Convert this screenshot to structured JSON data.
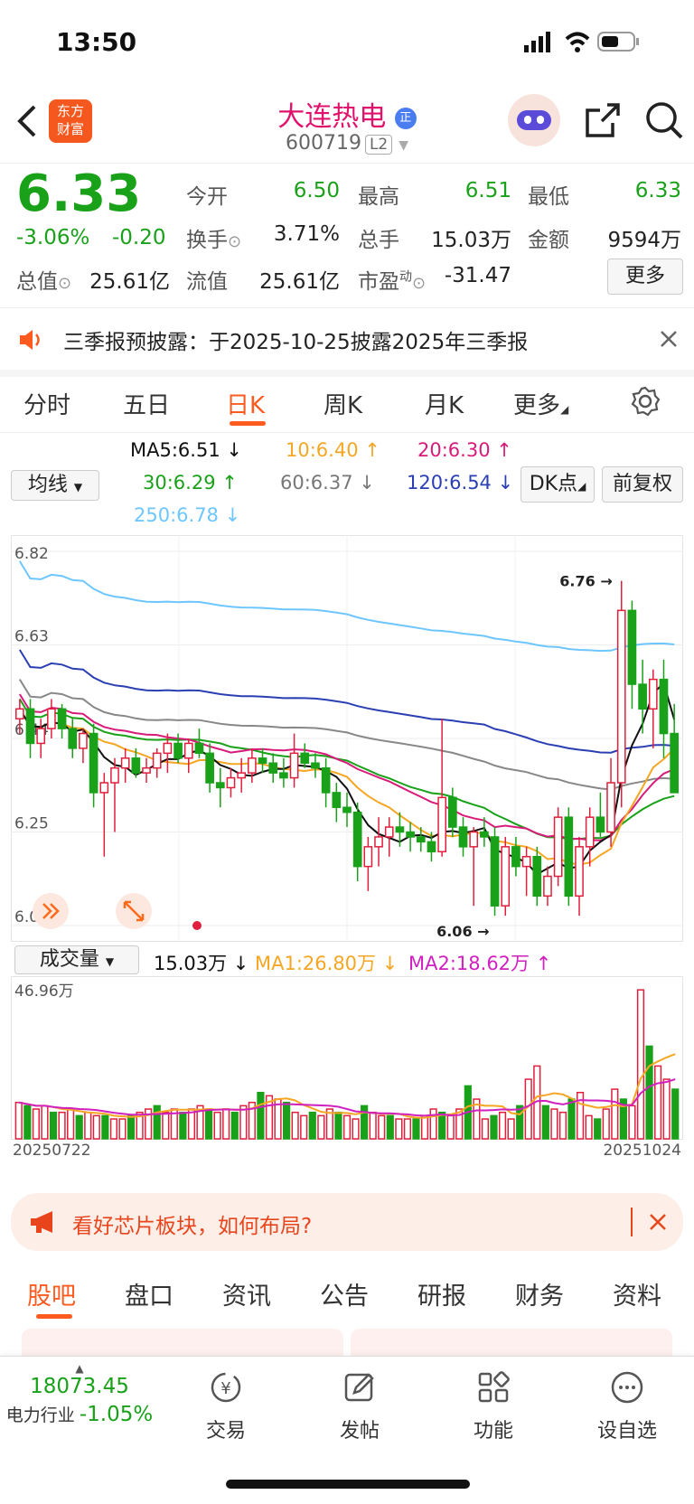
{
  "status": {
    "time": "13:50"
  },
  "header": {
    "brand_line1": "东方",
    "brand_line2": "财富",
    "title": "大连热电",
    "badge": "正",
    "code": "600719",
    "level": "L2"
  },
  "quote": {
    "price": "6.33",
    "change_pct": "-3.06%",
    "change": "-0.20",
    "open_label": "今开",
    "open": "6.50",
    "high_label": "最高",
    "high": "6.51",
    "low_label": "最低",
    "low": "6.33",
    "turnover_label": "换手",
    "turnover": "3.71%",
    "volume_label": "总手",
    "volume": "15.03万",
    "amount_label": "金额",
    "amount": "9594万",
    "mktcap_label": "总值",
    "mktcap": "25.61亿",
    "float_label": "流值",
    "float": "25.61亿",
    "pe_label": "市盈",
    "pe_sup": "动",
    "pe": "-31.47",
    "more": "更多"
  },
  "notice": {
    "text": "三季报预披露：于2025-10-25披露2025年三季报"
  },
  "ktabs": [
    "分时",
    "五日",
    "日K",
    "周K",
    "月K",
    "更多"
  ],
  "ma": {
    "selector": "均线",
    "ma5": "MA5:6.51",
    "ma10": "10:6.40",
    "ma20": "20:6.30",
    "ma30": "30:6.29",
    "ma60": "60:6.37",
    "ma120": "120:6.54",
    "ma250": "250:6.78",
    "dk": "DK点",
    "fq": "前复权"
  },
  "colors": {
    "up": "#e01f3d",
    "down": "#1aa11a",
    "ma5": "#111111",
    "ma10": "#f5a623",
    "ma20": "#d81b7a",
    "ma30": "#1aa11a",
    "ma60": "#888888",
    "ma120": "#2b3fb3",
    "ma250": "#6ec6ff",
    "accent": "#ff6a1a"
  },
  "chart_data": [
    {
      "type": "candlestick",
      "y_ticks": [
        "6.82",
        "6.63",
        "6.44",
        "6.25",
        "6.06"
      ],
      "ylim": [
        6.06,
        6.82
      ],
      "max_label": "6.76",
      "min_label": "6.06",
      "candles": [
        [
          6.48,
          6.52,
          6.45,
          6.5
        ],
        [
          6.5,
          6.52,
          6.4,
          6.43
        ],
        [
          6.43,
          6.48,
          6.4,
          6.46
        ],
        [
          6.46,
          6.52,
          6.44,
          6.5
        ],
        [
          6.5,
          6.51,
          6.44,
          6.46
        ],
        [
          6.46,
          6.48,
          6.4,
          6.42
        ],
        [
          6.42,
          6.46,
          6.39,
          6.45
        ],
        [
          6.45,
          6.47,
          6.3,
          6.33
        ],
        [
          6.33,
          6.37,
          6.2,
          6.35
        ],
        [
          6.35,
          6.4,
          6.25,
          6.38
        ],
        [
          6.38,
          6.42,
          6.35,
          6.4
        ],
        [
          6.4,
          6.42,
          6.36,
          6.37
        ],
        [
          6.37,
          6.4,
          6.35,
          6.38
        ],
        [
          6.38,
          6.42,
          6.36,
          6.41
        ],
        [
          6.41,
          6.45,
          6.37,
          6.43
        ],
        [
          6.43,
          6.45,
          6.39,
          6.4
        ],
        [
          6.4,
          6.44,
          6.37,
          6.43
        ],
        [
          6.43,
          6.46,
          6.4,
          6.41
        ],
        [
          6.41,
          6.43,
          6.33,
          6.35
        ],
        [
          6.35,
          6.38,
          6.3,
          6.34
        ],
        [
          6.34,
          6.38,
          6.32,
          6.36
        ],
        [
          6.36,
          6.4,
          6.33,
          6.37
        ],
        [
          6.37,
          6.42,
          6.35,
          6.4
        ],
        [
          6.4,
          6.42,
          6.37,
          6.39
        ],
        [
          6.39,
          6.41,
          6.35,
          6.37
        ],
        [
          6.37,
          6.4,
          6.34,
          6.36
        ],
        [
          6.36,
          6.45,
          6.34,
          6.41
        ],
        [
          6.41,
          6.43,
          6.38,
          6.39
        ],
        [
          6.39,
          6.41,
          6.36,
          6.38
        ],
        [
          6.38,
          6.4,
          6.3,
          6.33
        ],
        [
          6.33,
          6.35,
          6.27,
          6.3
        ],
        [
          6.3,
          6.33,
          6.26,
          6.29
        ],
        [
          6.29,
          6.31,
          6.15,
          6.18
        ],
        [
          6.18,
          6.24,
          6.13,
          6.22
        ],
        [
          6.22,
          6.28,
          6.18,
          6.24
        ],
        [
          6.24,
          6.28,
          6.2,
          6.26
        ],
        [
          6.26,
          6.29,
          6.22,
          6.25
        ],
        [
          6.25,
          6.27,
          6.21,
          6.24
        ],
        [
          6.24,
          6.26,
          6.21,
          6.23
        ],
        [
          6.23,
          6.25,
          6.19,
          6.21
        ],
        [
          6.21,
          6.48,
          6.2,
          6.32
        ],
        [
          6.32,
          6.34,
          6.24,
          6.26
        ],
        [
          6.26,
          6.28,
          6.2,
          6.22
        ],
        [
          6.22,
          6.26,
          6.1,
          6.25
        ],
        [
          6.25,
          6.28,
          6.22,
          6.24
        ],
        [
          6.24,
          6.26,
          6.08,
          6.1
        ],
        [
          6.1,
          6.24,
          6.08,
          6.22
        ],
        [
          6.22,
          6.24,
          6.16,
          6.18
        ],
        [
          6.18,
          6.22,
          6.12,
          6.2
        ],
        [
          6.2,
          6.22,
          6.1,
          6.12
        ],
        [
          6.12,
          6.18,
          6.1,
          6.16
        ],
        [
          6.16,
          6.3,
          6.14,
          6.28
        ],
        [
          6.28,
          6.3,
          6.1,
          6.12
        ],
        [
          6.12,
          6.24,
          6.08,
          6.22
        ],
        [
          6.22,
          6.3,
          6.18,
          6.28
        ],
        [
          6.28,
          6.33,
          6.24,
          6.25
        ],
        [
          6.25,
          6.4,
          6.22,
          6.35
        ],
        [
          6.35,
          6.76,
          6.3,
          6.7
        ],
        [
          6.7,
          6.72,
          6.5,
          6.55
        ],
        [
          6.55,
          6.6,
          6.45,
          6.5
        ],
        [
          6.5,
          6.58,
          6.42,
          6.56
        ],
        [
          6.56,
          6.6,
          6.4,
          6.45
        ],
        [
          6.45,
          6.51,
          6.33,
          6.33
        ]
      ]
    },
    {
      "type": "bar",
      "selector": "成交量",
      "vol": "15.03万",
      "ma1": "MA1:26.80万",
      "ma2": "MA2:18.62万",
      "y_max_label": "46.96万",
      "ylim": [
        0,
        46.96
      ],
      "x_start": "20250722",
      "x_end": "20251024",
      "values": [
        11,
        10,
        9,
        10,
        8,
        8,
        9,
        7,
        8,
        7,
        7,
        6,
        6,
        7,
        8,
        9,
        10,
        8,
        9,
        8,
        9,
        10,
        9,
        8,
        9,
        8,
        10,
        11,
        14,
        13,
        12,
        11,
        8,
        7,
        8,
        7,
        9,
        8,
        7,
        6,
        10,
        8,
        7,
        7,
        6,
        6,
        6,
        7,
        9,
        8,
        7,
        9,
        16,
        12,
        6,
        7,
        8,
        6,
        10,
        18,
        22,
        10,
        9,
        8,
        12,
        14,
        7,
        6,
        9,
        15,
        12,
        10,
        45,
        28,
        22,
        18,
        15
      ]
    }
  ],
  "ad": {
    "text": "看好芯片板块，如何布局?"
  },
  "btabs": [
    "股吧",
    "盘口",
    "资讯",
    "公告",
    "研报",
    "财务",
    "资料"
  ],
  "nav": {
    "index_value": "18073.45",
    "index_name": "电力行业",
    "index_change": "-1.05%",
    "trade": "交易",
    "post": "发帖",
    "func": "功能",
    "watch": "设自选"
  }
}
